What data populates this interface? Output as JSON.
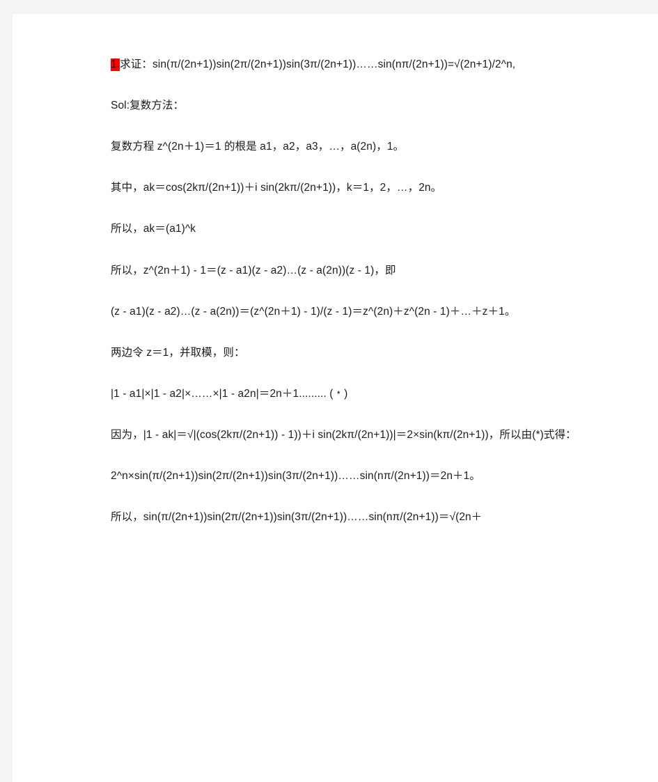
{
  "page": {
    "background_color": "#f4f4f5",
    "sheet_color": "#ffffff",
    "text_color": "#1b1b22",
    "highlight_color": "#ff0000"
  },
  "document": {
    "paragraphs": [
      {
        "id": "problem-statement",
        "highlight_prefix": "1.",
        "text": "求证：sin(π/(2n+1))sin(2π/(2n+1))sin(3π/(2n+1))……sin(nπ/(2n+1))=√(2n+1)/2^n,",
        "indent": true
      },
      {
        "id": "solution-heading",
        "text": "Sol:复数方法：",
        "indent": true
      },
      {
        "id": "roots-of-unity",
        "text": "复数方程 z^(2n＋1)＝1 的根是 a1，a2，a3，…，a(2n)，1。",
        "indent": true
      },
      {
        "id": "root-definition",
        "text": "其中，ak＝cos(2kπ/(2n+1))＋i sin(2kπ/(2n+1))，k＝1，2，…，2n。",
        "indent": true
      },
      {
        "id": "root-power",
        "text": "所以，ak＝(a1)^k",
        "indent": true
      },
      {
        "id": "factorization",
        "text": "所以，z^(2n＋1) - 1＝(z - a1)(z - a2)…(z - a(2n))(z - 1)，即",
        "indent": true
      },
      {
        "id": "geometric-expansion",
        "text": "(z - a1)(z - a2)…(z - a(2n))＝(z^(2n＋1) - 1)/(z - 1)＝z^(2n)＋z^(2n - 1)＋…＋z＋1。",
        "indent": true
      },
      {
        "id": "substitute-z-one",
        "text": "两边令 z＝1，并取模，则：",
        "indent": true
      },
      {
        "id": "modulus-product",
        "text": "|1 - a1|×|1 - a2|×……×|1 - a2n|＝2n＋1......... (﹡)",
        "indent": true
      },
      {
        "id": "modulus-derivation",
        "text": "因为，|1 - ak|＝√|(cos(2kπ/(2n+1)) - 1))＋i sin(2kπ/(2n+1))|＝2×sin(kπ/(2n+1))，所以由(*)式得：",
        "indent": true
      },
      {
        "id": "product-equation",
        "text": "2^n×sin(π/(2n+1))sin(2π/(2n+1))sin(3π/(2n+1))……sin(nπ/(2n+1))＝2n＋1。",
        "indent": true
      },
      {
        "id": "conclusion",
        "text": "所以，sin(π/(2n+1))sin(2π/(2n+1))sin(3π/(2n+1))……sin(nπ/(2n+1))＝√(2n＋",
        "indent": true
      }
    ]
  }
}
